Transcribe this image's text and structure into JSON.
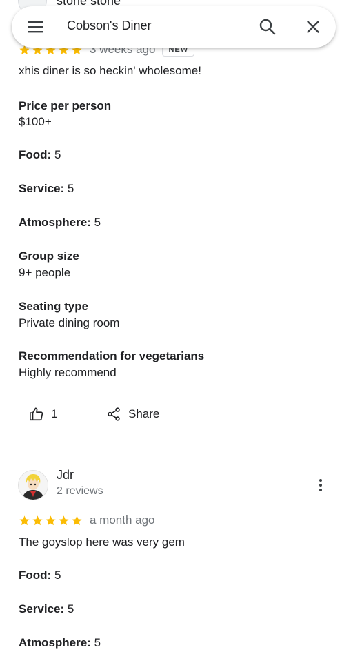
{
  "search": {
    "query": "Cobson's Diner"
  },
  "previous_review": {
    "reviewer_name_partial": "stone stone",
    "time_ago": "3 weeks ago",
    "new_badge": "NEW",
    "stars": 5,
    "text": "xhis diner is so heckin' wholesome!",
    "price_label": "Price per person",
    "price_value": "$100+",
    "food_label": "Food:",
    "food_value": "5",
    "service_label": "Service:",
    "service_value": "5",
    "atmosphere_label": "Atmosphere:",
    "atmosphere_value": "5",
    "group_label": "Group size",
    "group_value": "9+ people",
    "seating_label": "Seating type",
    "seating_value": "Private dining room",
    "veg_label": "Recommendation for vegetarians",
    "veg_value": "Highly recommend",
    "like_count": "1",
    "share_label": "Share"
  },
  "review": {
    "reviewer_name": "Jdr",
    "reviewer_count": "2 reviews",
    "stars": 5,
    "time_ago": "a month ago",
    "text": "The goyslop here was very gem",
    "food_label": "Food:",
    "food_value": "5",
    "service_label": "Service:",
    "service_value": "5",
    "atmosphere_label": "Atmosphere:",
    "atmosphere_value": "5"
  },
  "colors": {
    "star": "#fbbc04",
    "muted_text": "#70757a",
    "divider": "#e0e0e0"
  }
}
